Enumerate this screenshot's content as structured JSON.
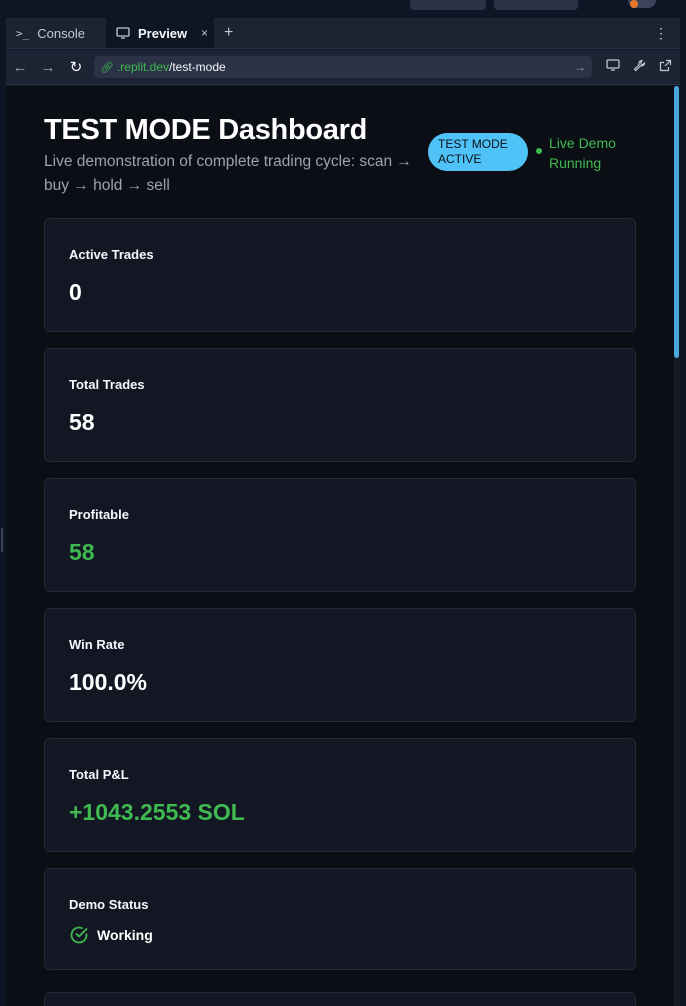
{
  "tabs": {
    "console_label": "Console",
    "preview_label": "Preview",
    "close_glyph": "×",
    "add_glyph": "+",
    "menu_glyph": "⋮"
  },
  "address": {
    "url_host": ".replit.dev",
    "url_path": "/test-mode"
  },
  "dashboard": {
    "title": "TEST MODE Dashboard",
    "subtitle": "Live demonstration of complete trading cycle: scan → buy → hold → sell",
    "mode_badge": "TEST MODE ACTIVE",
    "live_status": "Live Demo Running"
  },
  "cards": [
    {
      "label": "Active Trades",
      "value": "0"
    },
    {
      "label": "Total Trades",
      "value": "58"
    },
    {
      "label": "Profitable",
      "value": "58"
    },
    {
      "label": "Win Rate",
      "value": "100.0%"
    },
    {
      "label": "Total P&L",
      "value": "+1043.2553 SOL"
    },
    {
      "label": "Demo Status",
      "value": "Working"
    }
  ],
  "colors": {
    "accent_blue": "#4fc3f7",
    "positive_green": "#3fb950",
    "background": "#0b0e14",
    "card": "#121723"
  }
}
